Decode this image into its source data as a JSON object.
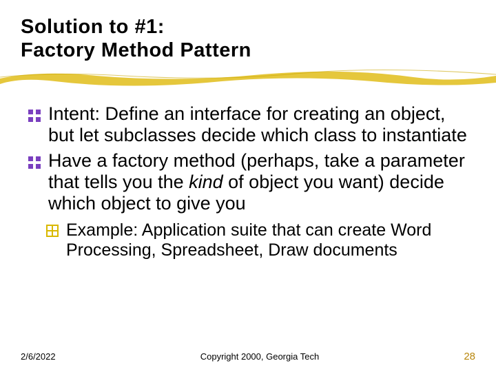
{
  "title": {
    "line1": "Solution to #1:",
    "line2": "Factory Method Pattern"
  },
  "bullets": {
    "b1": "Intent: Define an interface for creating an object, but let subclasses decide which class to instantiate",
    "b2_a": "Have a factory method (perhaps, take a parameter that tells you the ",
    "b2_kind": "kind",
    "b2_b": " of object you want) decide which object to give you",
    "sub1": "Example: Application suite that can create Word Processing, Spreadsheet, Draw documents"
  },
  "footer": {
    "date": "2/6/2022",
    "copyright": "Copyright 2000, Georgia Tech",
    "page": "28"
  },
  "colors": {
    "bullet_purple": "#7a3fbf",
    "sub_gold": "#d9b800",
    "brush_gold": "#e4c431",
    "page_gold": "#b8860b"
  }
}
